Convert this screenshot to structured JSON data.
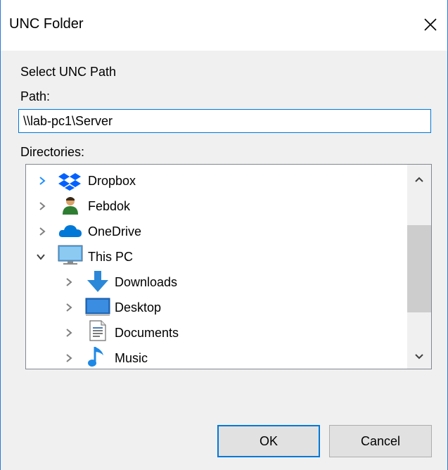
{
  "dialog": {
    "title": "UNC Folder",
    "select_label": "Select UNC Path",
    "path_label": "Path:",
    "path_value": "\\\\lab-pc1\\Server",
    "directories_label": "Directories:",
    "ok_label": "OK",
    "cancel_label": "Cancel"
  },
  "tree": {
    "items": [
      {
        "label": "Dropbox",
        "icon": "dropbox-icon",
        "expanded": false
      },
      {
        "label": "Febdok",
        "icon": "user-folder-icon",
        "expanded": false
      },
      {
        "label": "OneDrive",
        "icon": "onedrive-icon",
        "expanded": false
      },
      {
        "label": "This PC",
        "icon": "computer-icon",
        "expanded": true
      },
      {
        "label": "Downloads",
        "icon": "downloads-icon",
        "expanded": false
      },
      {
        "label": "Desktop",
        "icon": "desktop-icon",
        "expanded": false
      },
      {
        "label": "Documents",
        "icon": "documents-icon",
        "expanded": false
      },
      {
        "label": "Music",
        "icon": "music-icon",
        "expanded": false
      }
    ]
  },
  "colors": {
    "accent": "#0078d7",
    "window_border": "#2b78d6",
    "dialog_bg": "#f0f0f0"
  }
}
